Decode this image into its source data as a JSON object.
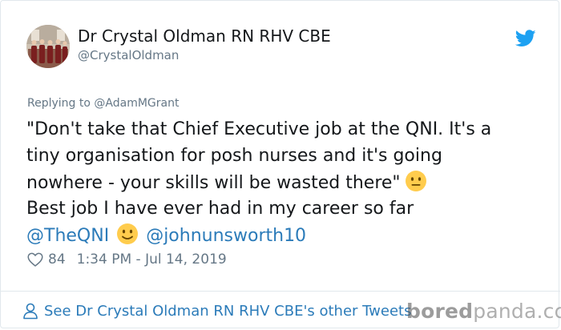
{
  "author": {
    "name": "Dr Crystal Oldman RN RHV CBE",
    "handle": "@CrystalOldman"
  },
  "reply": {
    "prefix": "Replying to",
    "to": "@AdamMGrant"
  },
  "tweet": {
    "line1": "\"Don't take that Chief Executive job at the QNI. It's a",
    "line2": "tiny organisation for posh nurses and it's going",
    "line3": "nowhere - your skills will be wasted there\"",
    "line4": "Best job I have ever had in my career so far",
    "mention1": "@TheQNI",
    "mention2": "@johnunsworth10"
  },
  "meta": {
    "likes": "84",
    "timestamp": "1:34 PM - Jul 14, 2019"
  },
  "footer": {
    "link_label": "See Dr Crystal Oldman RN RHV CBE's other Tweets"
  },
  "watermark": {
    "prefix": "bored",
    "suffix": "panda.com"
  },
  "colors": {
    "link": "#2b7bb9",
    "twitter_blue": "#1da1f2",
    "muted": "#657786",
    "text": "#14171a"
  },
  "icons": {
    "brand": "twitter-bird-icon",
    "like": "heart-icon",
    "profile": "person-icon",
    "emoji_1": "neutral-face-emoji",
    "emoji_2": "slightly-smiling-face-emoji"
  }
}
